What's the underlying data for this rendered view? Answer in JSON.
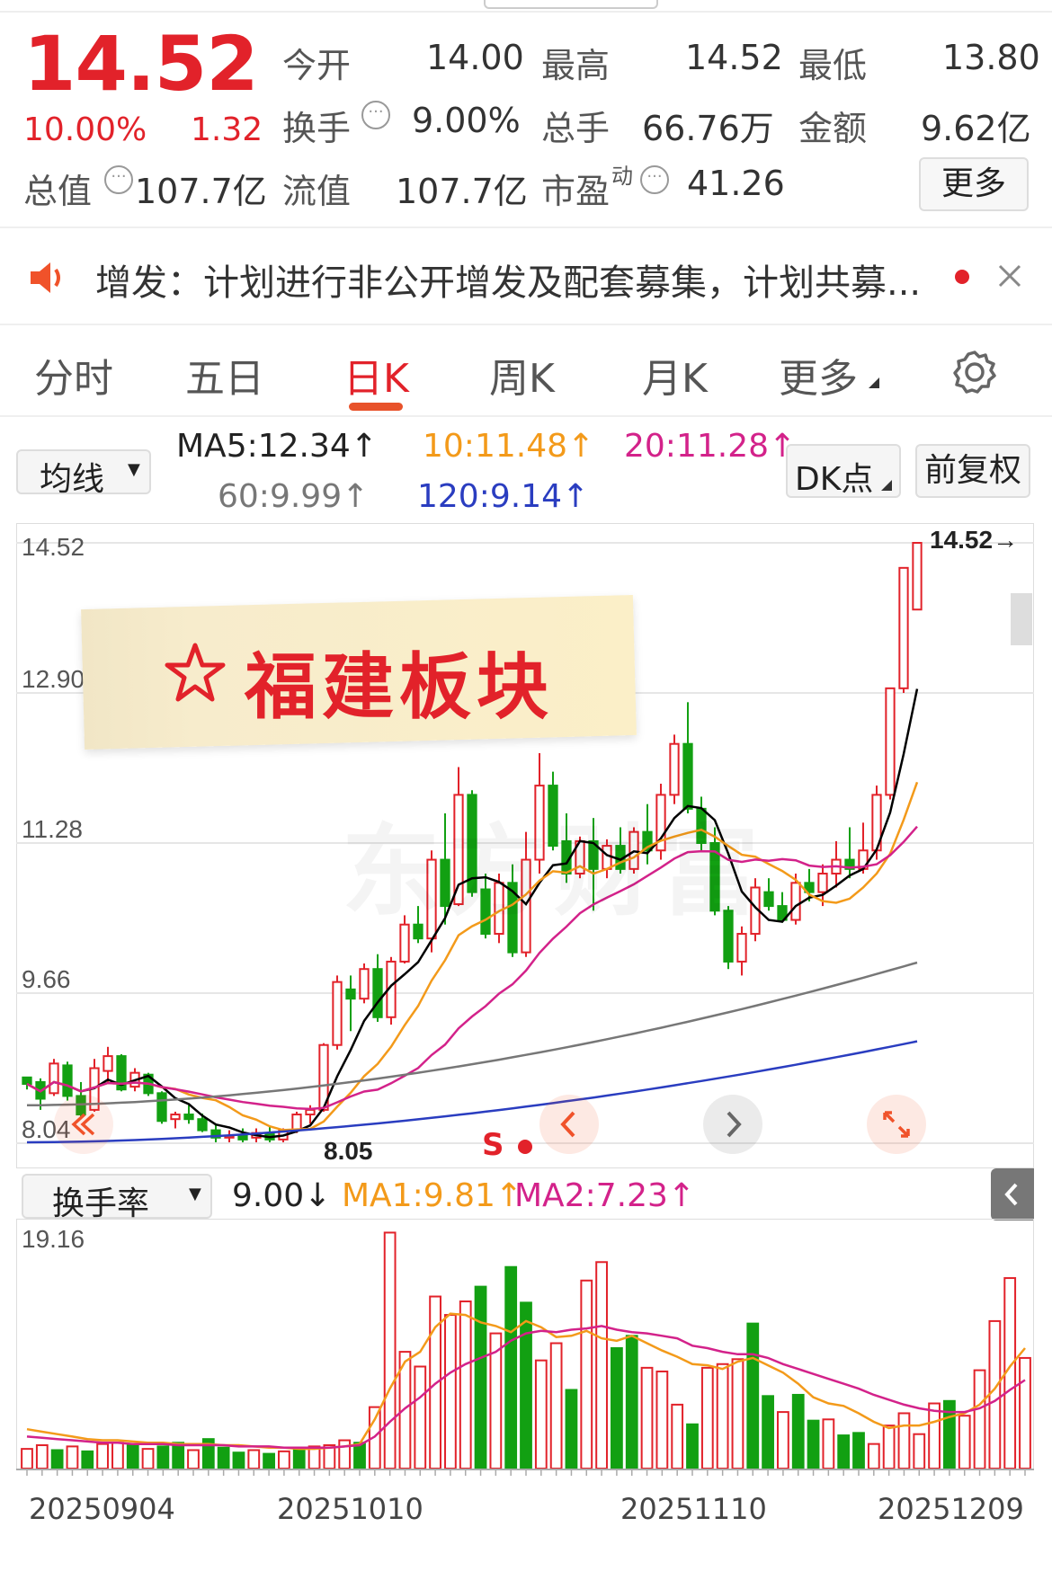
{
  "quote": {
    "price": "14.52",
    "change_pct": "10.00%",
    "change": "1.32",
    "open_label": "今开",
    "open": "14.00",
    "high_label": "最高",
    "high": "14.52",
    "low_label": "最低",
    "low": "13.80",
    "turnover_label": "换手",
    "turnover": "9.00%",
    "volume_label": "总手",
    "volume": "66.76万",
    "amount_label": "金额",
    "amount": "9.62亿",
    "mcap_label": "总值",
    "mcap": "107.7亿",
    "float_label": "流值",
    "float": "107.7亿",
    "pe_label": "市盈",
    "pe_sup": "动",
    "pe": "41.26",
    "more": "更多"
  },
  "notice": {
    "text": "增发：计划进行非公开增发及配套募集，计划共募..."
  },
  "tabs": [
    "分时",
    "五日",
    "日K",
    "周K",
    "月K",
    "更多"
  ],
  "active_tab": 2,
  "ma_bar": {
    "select": "均线",
    "ma5": "MA5:12.34↑",
    "ma10": "10:11.48↑",
    "ma20": "20:11.28↑",
    "ma60": "60:9.99↑",
    "ma120": "120:9.14↑",
    "dk": "DK点",
    "adjust": "前复权"
  },
  "kchart": {
    "y_labels": [
      "14.52",
      "12.90",
      "11.28",
      "9.66",
      "8.04"
    ],
    "max_label": "14.52→",
    "min_label": "8.05",
    "signal": "S",
    "sticker_text": "福建板块"
  },
  "volume_bar": {
    "select": "换手率",
    "value": "9.00↓",
    "ma1": "MA1:9.81↑",
    "ma2": "MA2:7.23↑"
  },
  "vchart": {
    "top_label": "19.16",
    "dates": [
      "20250904",
      "20251010",
      "20251110",
      "20251209"
    ]
  },
  "colors": {
    "up": "#e2222a",
    "down": "#12a012",
    "ma5": "#000000",
    "ma10": "#f39a1a",
    "ma20": "#d3228a",
    "ma60": "#777777",
    "ma120": "#2a3dc0"
  },
  "chart_data": {
    "type": "candlestick",
    "y_range": [
      8.04,
      14.52
    ],
    "candles": [
      [
        8.75,
        8.75,
        8.62,
        8.68
      ],
      [
        8.7,
        8.74,
        8.4,
        8.52
      ],
      [
        8.58,
        8.95,
        8.55,
        8.9
      ],
      [
        8.88,
        8.92,
        8.5,
        8.55
      ],
      [
        8.55,
        8.7,
        8.3,
        8.35
      ],
      [
        8.4,
        8.95,
        8.38,
        8.85
      ],
      [
        8.82,
        9.08,
        8.7,
        8.98
      ],
      [
        8.98,
        9.0,
        8.6,
        8.62
      ],
      [
        8.65,
        8.85,
        8.6,
        8.8
      ],
      [
        8.78,
        8.8,
        8.55,
        8.58
      ],
      [
        8.58,
        8.6,
        8.25,
        8.28
      ],
      [
        8.3,
        8.38,
        8.2,
        8.35
      ],
      [
        8.35,
        8.45,
        8.25,
        8.3
      ],
      [
        8.3,
        8.36,
        8.16,
        8.18
      ],
      [
        8.18,
        8.25,
        8.05,
        8.1
      ],
      [
        8.1,
        8.18,
        8.05,
        8.12
      ],
      [
        8.12,
        8.2,
        8.05,
        8.08
      ],
      [
        8.1,
        8.2,
        8.05,
        8.15
      ],
      [
        8.15,
        8.22,
        8.05,
        8.08
      ],
      [
        8.08,
        8.2,
        8.05,
        8.18
      ],
      [
        8.18,
        8.38,
        8.15,
        8.35
      ],
      [
        8.35,
        8.45,
        8.25,
        8.4
      ],
      [
        8.4,
        9.12,
        8.38,
        9.1
      ],
      [
        9.1,
        9.85,
        9.05,
        9.78
      ],
      [
        9.7,
        9.85,
        9.25,
        9.6
      ],
      [
        9.6,
        9.98,
        9.55,
        9.92
      ],
      [
        9.92,
        10.08,
        9.35,
        9.4
      ],
      [
        9.4,
        10.05,
        9.32,
        10.0
      ],
      [
        10.0,
        10.5,
        9.98,
        10.4
      ],
      [
        10.4,
        10.6,
        10.2,
        10.25
      ],
      [
        10.25,
        11.2,
        10.1,
        11.1
      ],
      [
        11.1,
        11.6,
        10.4,
        10.6
      ],
      [
        10.62,
        12.1,
        10.6,
        11.8
      ],
      [
        11.8,
        11.85,
        10.7,
        10.75
      ],
      [
        10.78,
        10.95,
        10.25,
        10.3
      ],
      [
        10.3,
        10.95,
        10.2,
        10.85
      ],
      [
        10.85,
        11.05,
        10.05,
        10.1
      ],
      [
        10.1,
        11.4,
        10.05,
        11.1
      ],
      [
        11.1,
        12.25,
        10.95,
        11.9
      ],
      [
        11.9,
        12.05,
        11.2,
        11.25
      ],
      [
        11.3,
        11.6,
        10.85,
        10.95
      ],
      [
        10.95,
        11.35,
        10.9,
        11.3
      ],
      [
        11.3,
        11.55,
        10.55,
        11.0
      ],
      [
        11.0,
        11.32,
        10.9,
        11.25
      ],
      [
        11.25,
        11.45,
        10.95,
        11.0
      ],
      [
        11.0,
        11.45,
        10.95,
        11.4
      ],
      [
        11.4,
        11.7,
        11.05,
        11.2
      ],
      [
        11.2,
        11.92,
        11.1,
        11.8
      ],
      [
        11.8,
        12.45,
        11.7,
        12.35
      ],
      [
        12.35,
        12.8,
        11.6,
        11.65
      ],
      [
        11.65,
        11.78,
        11.2,
        11.28
      ],
      [
        11.28,
        11.45,
        10.5,
        10.55
      ],
      [
        10.55,
        10.6,
        9.92,
        10.0
      ],
      [
        10.0,
        10.38,
        9.85,
        10.3
      ],
      [
        10.3,
        10.9,
        10.22,
        10.8
      ],
      [
        10.75,
        10.9,
        10.55,
        10.6
      ],
      [
        10.6,
        10.75,
        10.42,
        10.45
      ],
      [
        10.45,
        10.95,
        10.4,
        10.85
      ],
      [
        10.85,
        11.0,
        10.65,
        10.75
      ],
      [
        10.75,
        11.05,
        10.6,
        10.95
      ],
      [
        10.95,
        11.3,
        10.8,
        11.1
      ],
      [
        11.1,
        11.45,
        10.9,
        11.0
      ],
      [
        11.0,
        11.5,
        10.95,
        11.2
      ],
      [
        11.2,
        11.9,
        11.1,
        11.8
      ],
      [
        11.8,
        12.95,
        11.75,
        12.95
      ],
      [
        12.95,
        14.25,
        12.9,
        14.25
      ],
      [
        13.8,
        14.52,
        13.8,
        14.52
      ]
    ],
    "turnover": [
      [
        1.6,
        1
      ],
      [
        1.9,
        1
      ],
      [
        1.5,
        0
      ],
      [
        1.8,
        1
      ],
      [
        1.4,
        0
      ],
      [
        2.0,
        1
      ],
      [
        2.1,
        1
      ],
      [
        1.9,
        0
      ],
      [
        1.6,
        1
      ],
      [
        1.8,
        0
      ],
      [
        2.1,
        0
      ],
      [
        1.5,
        1
      ],
      [
        2.4,
        0
      ],
      [
        1.7,
        0
      ],
      [
        1.3,
        0
      ],
      [
        1.5,
        1
      ],
      [
        1.2,
        0
      ],
      [
        1.4,
        1
      ],
      [
        1.6,
        0
      ],
      [
        1.8,
        1
      ],
      [
        1.9,
        1
      ],
      [
        2.3,
        1
      ],
      [
        2.1,
        0
      ],
      [
        5.0,
        1
      ],
      [
        19.2,
        1
      ],
      [
        9.5,
        1
      ],
      [
        8.3,
        1
      ],
      [
        14.0,
        1
      ],
      [
        12.5,
        1
      ],
      [
        13.6,
        1
      ],
      [
        14.8,
        0
      ],
      [
        11.0,
        1
      ],
      [
        16.4,
        0
      ],
      [
        13.5,
        0
      ],
      [
        8.8,
        1
      ],
      [
        10.2,
        1
      ],
      [
        6.4,
        0
      ],
      [
        15.3,
        1
      ],
      [
        16.8,
        1
      ],
      [
        9.8,
        0
      ],
      [
        10.8,
        0
      ],
      [
        8.2,
        1
      ],
      [
        7.9,
        1
      ],
      [
        5.2,
        1
      ],
      [
        3.6,
        0
      ],
      [
        8.2,
        1
      ],
      [
        8.5,
        1
      ],
      [
        8.9,
        1
      ],
      [
        11.8,
        0
      ],
      [
        5.9,
        0
      ],
      [
        4.6,
        1
      ],
      [
        6.0,
        0
      ],
      [
        3.9,
        0
      ],
      [
        4.0,
        1
      ],
      [
        2.7,
        0
      ],
      [
        2.9,
        0
      ],
      [
        2.0,
        1
      ],
      [
        3.5,
        1
      ],
      [
        4.5,
        1
      ],
      [
        2.8,
        1
      ],
      [
        5.3,
        1
      ],
      [
        5.5,
        0
      ],
      [
        4.3,
        1
      ],
      [
        8.0,
        1
      ],
      [
        12.0,
        1
      ],
      [
        15.5,
        1
      ],
      [
        9.0,
        1
      ]
    ],
    "ma_turnover": {
      "MA1": [
        3.2,
        3.0,
        2.8,
        2.6,
        2.4,
        2.3,
        2.3,
        2.2,
        2.1,
        2.1,
        2.0,
        2.0,
        2.0,
        1.9,
        1.9,
        1.8,
        1.7,
        1.7,
        1.6,
        1.6,
        1.7,
        1.8,
        2.0,
        4.0,
        6.5,
        8.7,
        9.5,
        11.5,
        12.6,
        12.5,
        11.9,
        11.6,
        11.1,
        12.0,
        11.5,
        10.7,
        10.8,
        11.2,
        10.6,
        10.4,
        10.8,
        10.2,
        9.6,
        9.1,
        8.5,
        8.4,
        8.1,
        8.7,
        9.0,
        8.4,
        7.8,
        6.9,
        5.8,
        5.3,
        5.1,
        4.5,
        3.8,
        3.3,
        3.5,
        3.5,
        3.8,
        4.2,
        4.5,
        5.2,
        6.5,
        8.3,
        9.8
      ],
      "MA2": [
        2.6,
        2.5,
        2.4,
        2.3,
        2.2,
        2.1,
        2.1,
        2.0,
        2.0,
        2.0,
        1.9,
        1.9,
        1.9,
        1.9,
        1.8,
        1.8,
        1.8,
        1.7,
        1.7,
        1.7,
        1.7,
        1.8,
        1.9,
        2.6,
        3.8,
        4.9,
        5.8,
        6.9,
        7.8,
        8.5,
        9.0,
        9.5,
        10.4,
        11.0,
        11.2,
        11.1,
        11.3,
        11.4,
        11.6,
        11.3,
        11.1,
        11.0,
        10.8,
        10.6,
        10.0,
        9.8,
        9.5,
        9.3,
        9.3,
        9.0,
        8.5,
        8.1,
        7.7,
        7.3,
        6.9,
        6.5,
        6.0,
        5.6,
        5.2,
        4.9,
        4.7,
        4.6,
        4.6,
        4.9,
        5.5,
        6.4,
        7.2
      ]
    }
  }
}
